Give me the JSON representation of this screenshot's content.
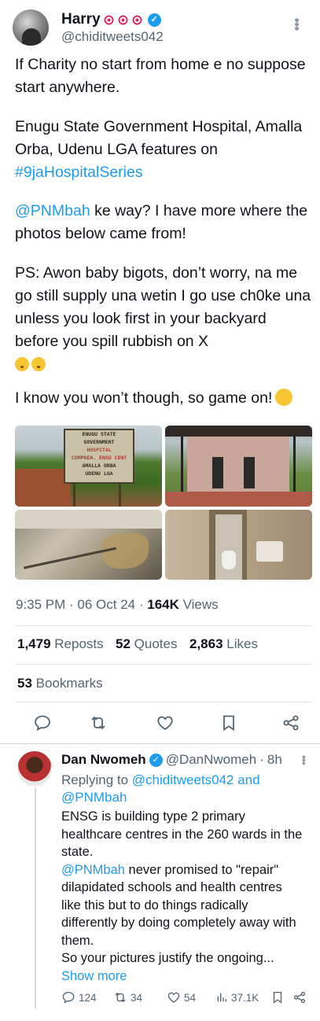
{
  "tweet": {
    "author_name": "Harry",
    "author_handle": "@chiditweets042",
    "name_emojis": [
      "target-icon",
      "target-icon",
      "target-icon"
    ],
    "para1": "If Charity no start from home e no suppose start anywhere.",
    "para2": "Enugu State Government Hospital, Amalla Orba, Udenu LGA features on",
    "hashtag": "#9jaHospitalSeries",
    "mention": "@PNMbah",
    "para3_rest": " ke way? I have more where the photos below came from!",
    "para4": "PS: Awon baby bigots, don’t worry, na me go still supply una wetin I go use ch0ke una unless you look first in your backyard before you spill rubbish on X",
    "para5": "I know you won’t though, so game on!",
    "sign_text": [
      "ENUGU STATE",
      "GOVERNMENT",
      "HOSPITAL",
      "COMPREH. ENSU CENT",
      "AMALLA ORBA",
      "UDENU LGA"
    ],
    "time": "9:35 PM",
    "date": "06 Oct 24",
    "views_count": "164K",
    "views_label": "Views",
    "reposts_count": "1,479",
    "reposts_label": "Reposts",
    "quotes_count": "52",
    "quotes_label": "Quotes",
    "likes_count": "2,863",
    "likes_label": "Likes",
    "bookmarks_count": "53",
    "bookmarks_label": "Bookmarks"
  },
  "reply": {
    "author_name": "Dan Nwomeh",
    "author_handle": "@DanNwomeh",
    "time": "8h",
    "replying_prefix": "Replying to",
    "replying_to_1": "@chiditweets042",
    "replying_and": "and",
    "replying_to_2": "@PNMbah",
    "text1": "ENSG is building type 2 primary healthcare centres in the 260 wards in the state.",
    "mention": "@PNMbah",
    "text2": " never promised to \"repair\" dilapidated schools and health centres like this but to do things radically differently by doing completely away with them.",
    "text3": "So your pictures justify the ongoing...",
    "show_more": "Show more",
    "replies": "124",
    "reposts": "34",
    "likes": "54",
    "views": "37.1K"
  },
  "colors": {
    "accent": "#1d9bf0",
    "muted": "#536471",
    "text": "#0f1419"
  }
}
